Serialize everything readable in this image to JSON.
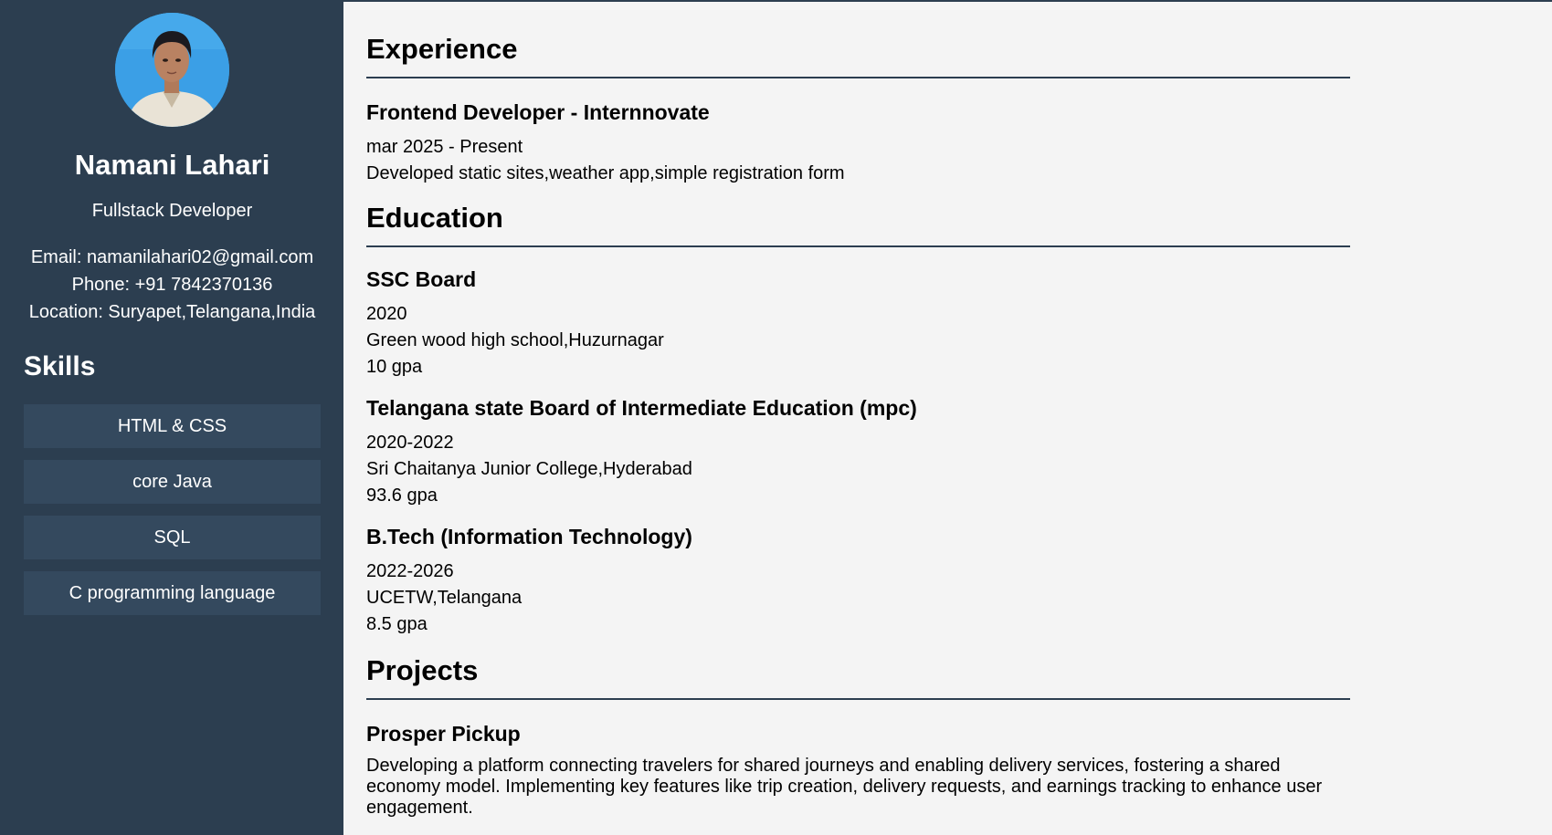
{
  "sidebar": {
    "name": "Namani Lahari",
    "title": "Fullstack Developer",
    "email": "Email: namanilahari02@gmail.com",
    "phone": "Phone: +91 7842370136",
    "location": "Location: Suryapet,Telangana,India",
    "skills_heading": "Skills",
    "skills": [
      "HTML & CSS",
      "core Java",
      "SQL",
      "C programming language"
    ]
  },
  "experience": {
    "heading": "Experience",
    "items": [
      {
        "title": "Frontend Developer - Internnovate",
        "dates": "mar 2025 - Present",
        "description": "Developed static sites,weather app,simple registration form"
      }
    ]
  },
  "education": {
    "heading": "Education",
    "items": [
      {
        "title": "SSC Board",
        "years": "2020",
        "institution": "Green wood high school,Huzurnagar",
        "score": "10 gpa"
      },
      {
        "title": "Telangana state Board of Intermediate Education (mpc)",
        "years": "2020-2022",
        "institution": "Sri Chaitanya Junior College,Hyderabad",
        "score": "93.6 gpa"
      },
      {
        "title": "B.Tech (Information Technology)",
        "years": "2022-2026",
        "institution": "UCETW,Telangana",
        "score": "8.5 gpa"
      }
    ]
  },
  "projects": {
    "heading": "Projects",
    "items": [
      {
        "title": "Prosper Pickup",
        "description": "Developing a platform connecting travelers for shared journeys and enabling delivery services, fostering a shared economy model. Implementing key features like trip creation, delivery requests, and earnings tracking to enhance user engagement."
      }
    ]
  },
  "colors": {
    "sidebar_bg": "#2c3e50",
    "skill_bg": "#34495e",
    "page_bg": "#f4f4f4"
  }
}
